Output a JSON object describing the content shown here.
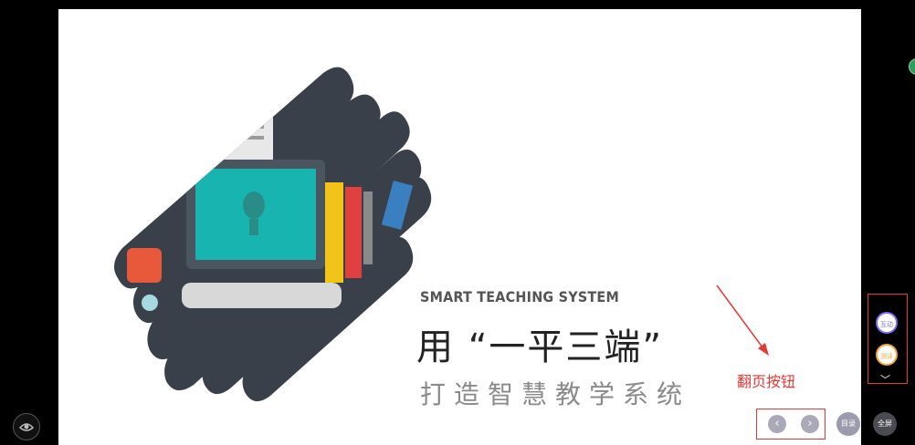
{
  "slide": {
    "english_title": "SMART TEACHING SYSTEM",
    "chinese_title": "用 “一平三端”",
    "chinese_subtitle": "打造智慧教学系统"
  },
  "annotation": {
    "label": "翻页按钮",
    "color": "#e53935"
  },
  "controls": {
    "prev_icon": "chevron-left-icon",
    "prev_glyph": "‹",
    "next_icon": "chevron-right-icon",
    "next_glyph": "›",
    "catalog_label": "目录",
    "fullscreen_label": "全屏"
  },
  "side_panel": {
    "interact_label": "互动",
    "rate_label": "测评",
    "collapse_glyph": "﹀"
  },
  "colors": {
    "stripe_dark": "#3a4049",
    "screen_teal": "#17b4b0",
    "book_yellow": "#f2c318",
    "book_red": "#e04040",
    "book_blue": "#3a7fc0",
    "mug_orange": "#e8583a",
    "interact_accent": "#7b6cf6",
    "rate_accent": "#f5a23a"
  }
}
